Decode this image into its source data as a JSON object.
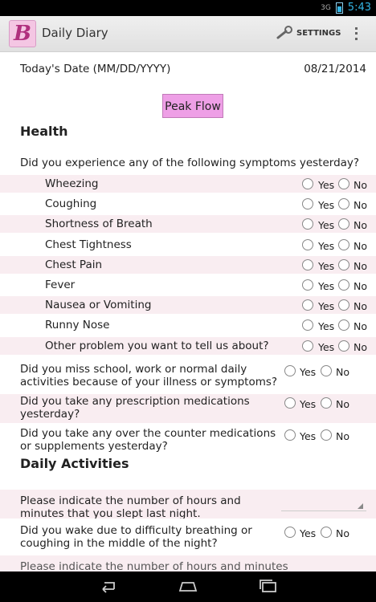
{
  "status": {
    "time": "5:43",
    "signal": "3G"
  },
  "appbar": {
    "title": "Daily Diary",
    "logo_letter": "B",
    "settings_label": "SETTINGS"
  },
  "date": {
    "label": "Today's Date (MM/DD/YYYY)",
    "value": "08/21/2014"
  },
  "peak_flow_label": "Peak Flow",
  "health": {
    "heading": "Health",
    "symptoms_question": "Did you experience any of the following symptoms yesterday?",
    "symptoms": [
      "Wheezing",
      "Coughing",
      "Shortness of Breath",
      "Chest Tightness",
      "Chest Pain",
      "Fever",
      "Nausea or Vomiting",
      "Runny Nose",
      "Other problem you want to tell us about?"
    ],
    "yes": "Yes",
    "no": "No",
    "q_missed": "Did you miss school, work or normal daily activities because of your illness or symptoms?",
    "q_prescription": "Did you take any prescription medications yesterday?",
    "q_otc": "Did you take any over the counter medications or supplements yesterday?"
  },
  "activities": {
    "heading": "Daily Activities",
    "q_sleep": "Please indicate the number of hours and minutes that you slept last night.",
    "q_wake": "Did you wake due to difficulty breathing or coughing in the middle of the night?",
    "q_partial": "Please indicate the number of hours and minutes"
  }
}
